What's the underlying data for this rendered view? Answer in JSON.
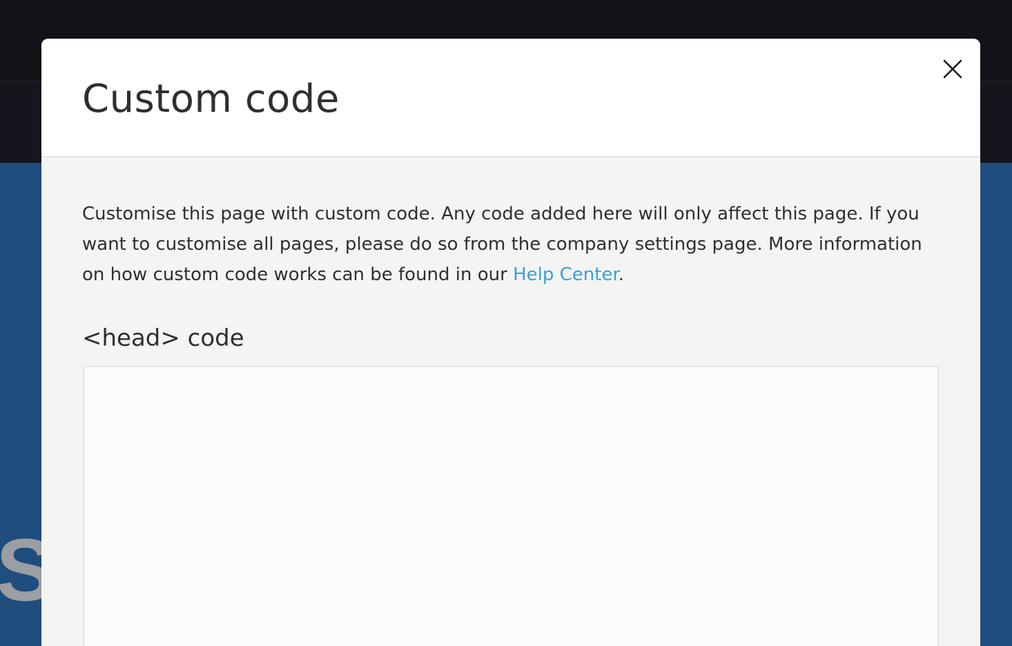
{
  "background": {
    "hero_fragment": "Se"
  },
  "modal": {
    "title": "Custom code",
    "close_icon": "close-icon",
    "description": {
      "text_before_link": "Customise this page with custom code. Any code added here will only affect this page. If you want to customise all pages, please do so from the company settings page. More information on how custom code works can be found in our ",
      "link_text": "Help Center",
      "text_after_link": "."
    },
    "head_code": {
      "label": "<head> code",
      "value": ""
    }
  },
  "colors": {
    "top_bar": "#121218",
    "hero": "#1f4d7e",
    "modal_body": "#f4f4f2",
    "link": "#3b9fdc",
    "text": "#2f2f2f"
  }
}
